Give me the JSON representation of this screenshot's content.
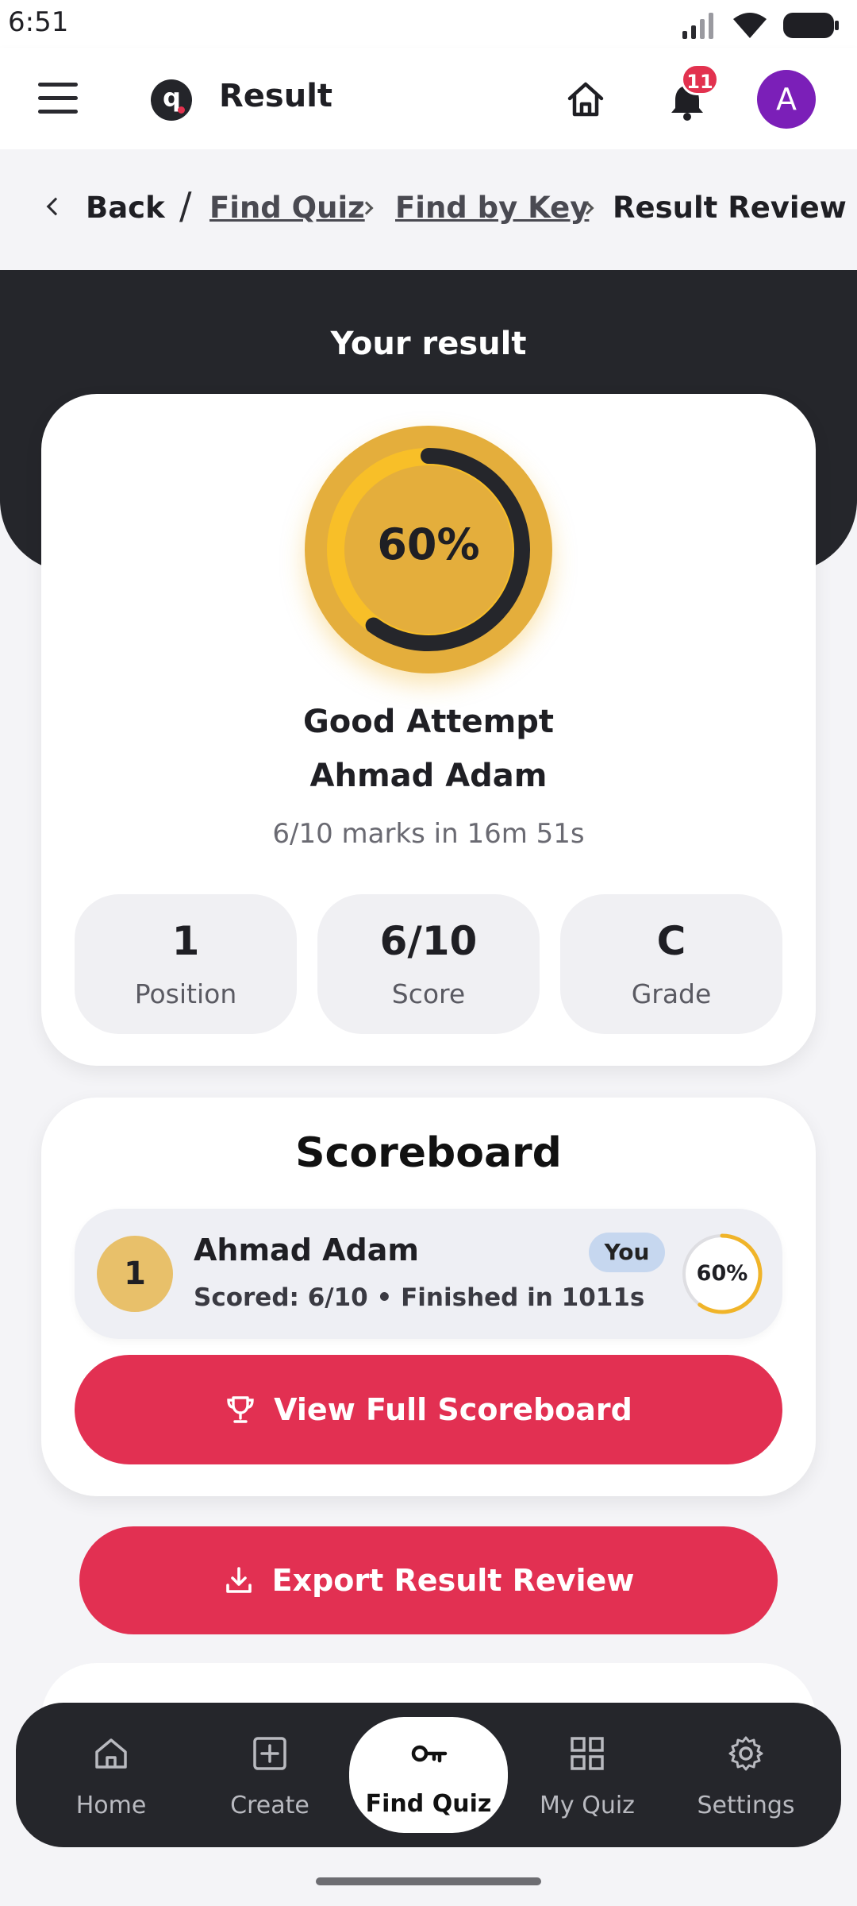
{
  "status_bar": {
    "time": "6:51"
  },
  "app_bar": {
    "title": "Result",
    "notification_count": "11",
    "avatar_initial": "A",
    "accent": "#e2324f",
    "avatar_color": "#7b1fb8"
  },
  "breadcrumb": {
    "back": "Back",
    "separator": "/",
    "items": [
      "Find Quiz",
      "Find by Key"
    ],
    "current": "Result Review"
  },
  "result": {
    "heading": "Your result",
    "percent_label": "60%",
    "percent_value": 0.6,
    "status": "Good Attempt",
    "name": "Ahmad Adam",
    "summary": "6/10 marks in 16m 51s",
    "stats": [
      {
        "value": "1",
        "label": "Position"
      },
      {
        "value": "6/10",
        "label": "Score"
      },
      {
        "value": "C",
        "label": "Grade"
      }
    ]
  },
  "scoreboard": {
    "title": "Scoreboard",
    "rows": [
      {
        "position": "1",
        "name": "Ahmad Adam",
        "detail": "Scored: 6/10 • Finished in 1011s",
        "tag": "You",
        "percent_label": "60%",
        "percent_value": 0.6
      }
    ],
    "view_full_label": "View Full Scoreboard"
  },
  "export_label": "Export Result Review",
  "bottom_nav": {
    "items": [
      {
        "label": "Home",
        "icon": "home-icon"
      },
      {
        "label": "Create",
        "icon": "plus-square-icon"
      },
      {
        "label": "Find Quiz",
        "icon": "key-icon"
      },
      {
        "label": "My Quiz",
        "icon": "grid-icon"
      },
      {
        "label": "Settings",
        "icon": "gear-icon"
      }
    ],
    "active": "Find Quiz"
  }
}
